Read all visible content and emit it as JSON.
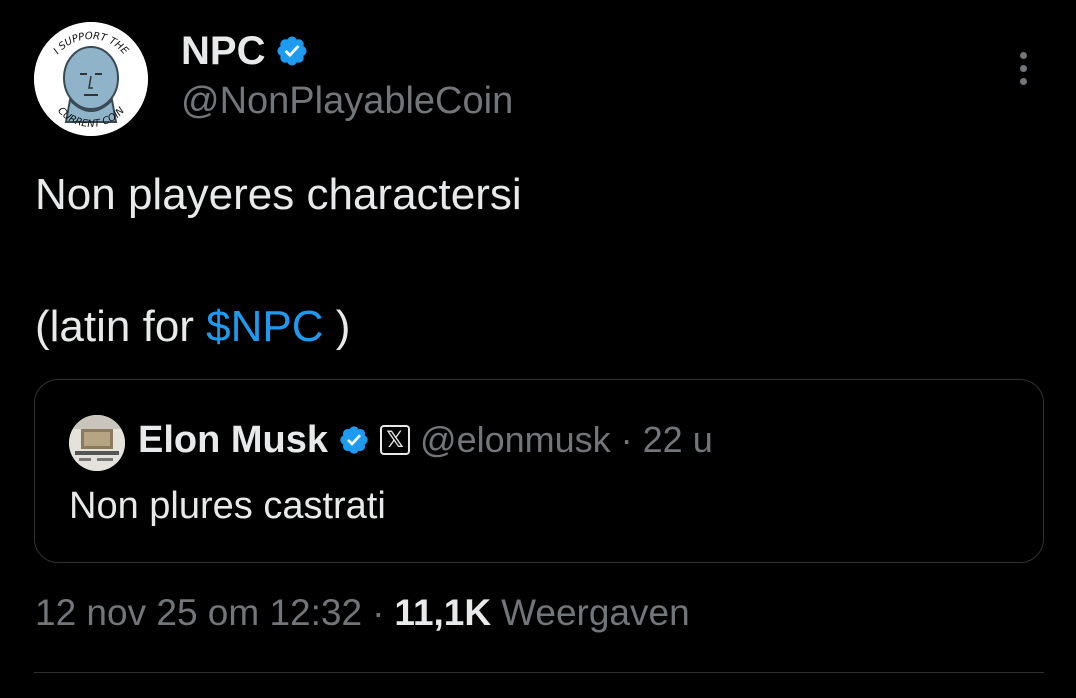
{
  "author": {
    "display_name": "NPC",
    "handle": "@NonPlayableCoin",
    "avatar_arc_top": "I SUPPORT THE",
    "avatar_arc_bottom": "CURRENT COIN",
    "verified_icon": "verified-badge-icon"
  },
  "tweet": {
    "line1": "Non playeres charactersi",
    "line2_prefix": "(latin for ",
    "cashtag": "$NPC",
    "line2_suffix": " )"
  },
  "quote": {
    "display_name": "Elon Musk",
    "affiliate_badge": "𝕏",
    "handle": "@elonmusk",
    "dot": "·",
    "time": "22 u",
    "text": "Non plures castrati"
  },
  "meta": {
    "timestamp": "12 nov 25 om 12:32",
    "dot": "·",
    "views_count": "11,1K",
    "views_label": "Weergaven"
  },
  "colors": {
    "background": "#000000",
    "text": "#e7e9ea",
    "secondary": "#71767b",
    "accent": "#1d9bf0",
    "border": "#2f3336"
  }
}
